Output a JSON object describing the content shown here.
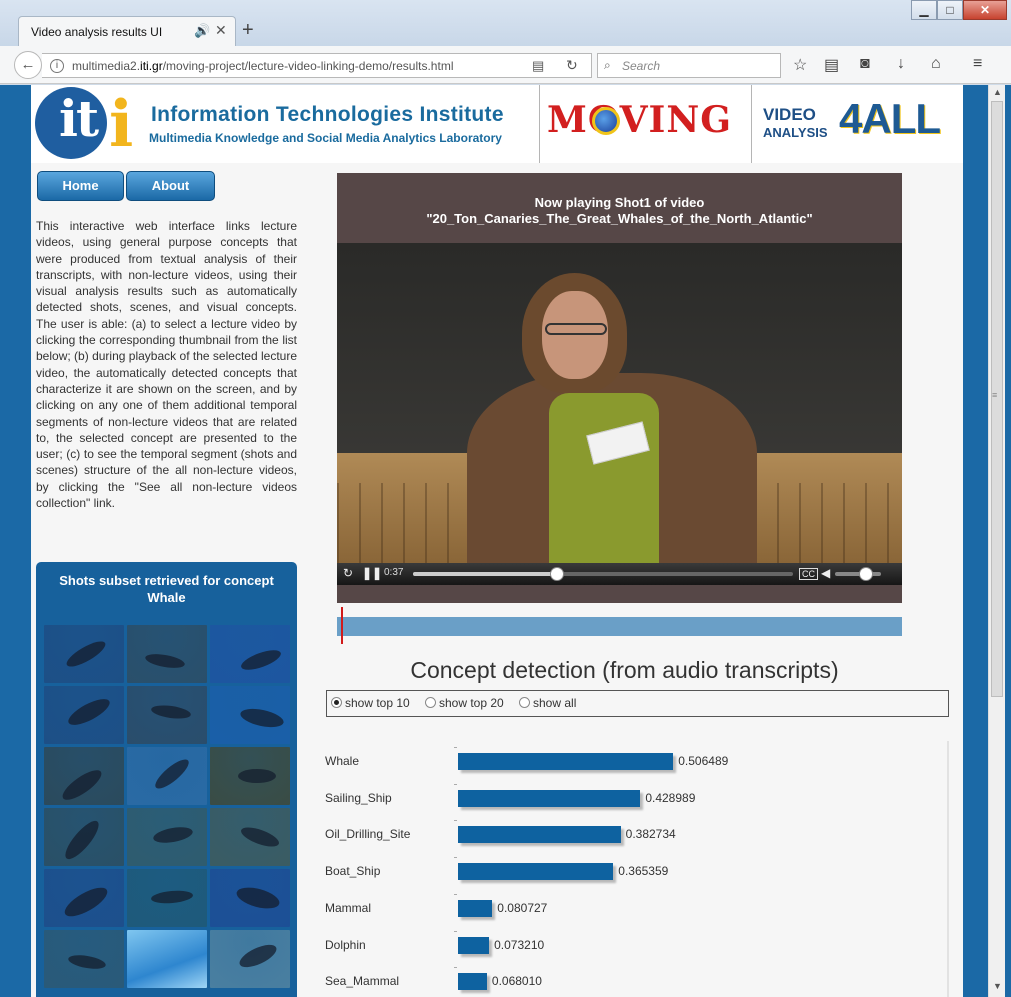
{
  "browser": {
    "tab_title": "Video analysis results UI",
    "url_prefix": "multimedia2.",
    "url_host": "iti.gr",
    "url_path": "/moving-project/lecture-video-linking-demo/results.html",
    "search_placeholder": "Search",
    "win_min": "▁",
    "win_max": "□",
    "win_close": "✕",
    "new_tab": "+"
  },
  "header": {
    "iti_letters": "it",
    "iti_i": "i",
    "institute_name": "Information Technologies Institute",
    "lab_name": "Multimedia Knowledge and Social Media Analytics Laboratory",
    "moving_logo": "MOVING",
    "v4a_video": "VIDEO",
    "v4a_analysis": "ANALYSIS",
    "v4a_4all": "4ALL"
  },
  "nav": {
    "home": "Home",
    "about": "About"
  },
  "description": "This interactive web interface links lecture videos, using general purpose concepts that were produced from textual analysis of their transcripts, with non-lecture videos, using their visual analysis results such as automatically detected shots, scenes, and visual concepts. The user is able: (a) to select a lecture video by clicking the corresponding thumbnail from the list below; (b) during playback of the selected lecture video, the automatically detected concepts that characterize it are shown on the screen, and by clicking on any one of them additional temporal segments of non-lecture videos that are related to, the selected concept are presented to the user; (c) to see the temporal segment (shots and scenes) structure of the all non-lecture videos, by clicking the \"See all non-lecture videos collection\" link.",
  "shots_panel": {
    "title_line1": "Shots subset retrieved for concept",
    "title_line2": "Whale",
    "thumbnails": [
      {
        "bg": "#1d4f86",
        "whale": true
      },
      {
        "bg": "#2a4f6a",
        "whale": true
      },
      {
        "bg": "#1d56a0",
        "whale": true
      },
      {
        "bg": "#1d4f86",
        "whale": true
      },
      {
        "bg": "#2a4d6b",
        "whale": true
      },
      {
        "bg": "#1a5fa8",
        "whale": true
      },
      {
        "bg": "#2b4a5c",
        "whale": true
      },
      {
        "bg": "#2a6aa4",
        "whale": true
      },
      {
        "bg": "#3a4c44",
        "whale": true
      },
      {
        "bg": "#2a5066",
        "whale": true
      },
      {
        "bg": "#2f5c6e",
        "whale": true
      },
      {
        "bg": "#3b5c62",
        "whale": true
      },
      {
        "bg": "#1d4f8c",
        "whale": true
      },
      {
        "bg": "#1e5a7a",
        "whale": true
      },
      {
        "bg": "#1c4f96",
        "whale": true
      },
      {
        "bg": "#2a5a78",
        "whale": true
      },
      {
        "bg": "#3d8ed0",
        "whale": false
      },
      {
        "bg": "#4a7fa0",
        "whale": true
      }
    ]
  },
  "player": {
    "now_playing_line1": "Now playing Shot1 of video",
    "now_playing_line2": "\"20_Ton_Canaries_The_Great_Whales_of_the_North_Atlantic\"",
    "time": "0:37",
    "progress": 0.38,
    "volume": 0.75
  },
  "concepts": {
    "title": "Concept detection (from audio transcripts)",
    "options": [
      "show top 10",
      "show top 20",
      "show all"
    ],
    "selected": "show top 10"
  },
  "chart_data": {
    "type": "bar",
    "orientation": "horizontal",
    "categories": [
      "Whale",
      "Sailing_Ship",
      "Oil_Drilling_Site",
      "Boat_Ship",
      "Mammal",
      "Dolphin",
      "Sea_Mammal"
    ],
    "values": [
      0.506489,
      0.428989,
      0.382734,
      0.365359,
      0.080727,
      0.07321,
      0.06801
    ],
    "value_labels": [
      "0.506489",
      "0.428989",
      "0.382734",
      "0.365359",
      "0.080727",
      "0.073210",
      "0.068010"
    ],
    "title": "",
    "xlabel": "",
    "ylabel": "",
    "xlim": [
      0,
      0.6
    ],
    "colors": {
      "bar": "#0e62a0"
    }
  }
}
